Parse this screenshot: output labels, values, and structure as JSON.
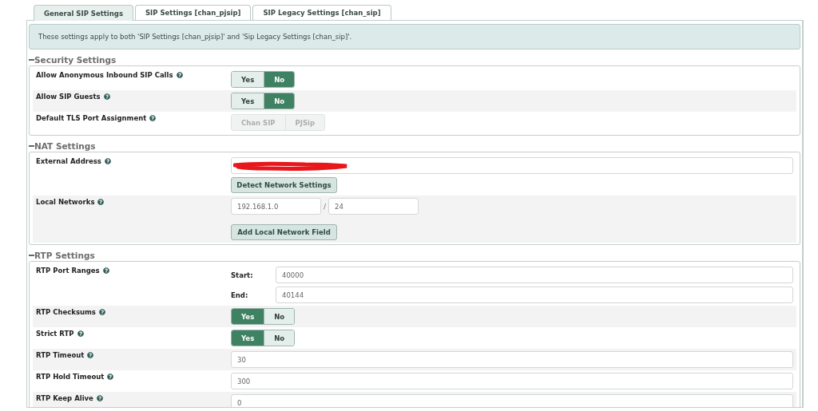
{
  "tabs": [
    {
      "label": "General SIP Settings",
      "selected": true
    },
    {
      "label": "SIP Settings [chan_pjsip]",
      "selected": false
    },
    {
      "label": "SIP Legacy Settings [chan_sip]",
      "selected": false
    }
  ],
  "info": "These settings apply to both 'SIP Settings [chan_pjsip]' and 'Sip Legacy Settings [chan_sip]'.",
  "sections": [
    {
      "title": "Security Settings",
      "expanded": true,
      "rows": [
        {
          "kind": "toggle",
          "label": "Allow Anonymous Inbound SIP Calls",
          "disabled": false,
          "options": [
            {
              "label": "Yes",
              "selected": false
            },
            {
              "label": "No",
              "selected": true
            }
          ]
        },
        {
          "kind": "toggle",
          "label": "Allow SIP Guests",
          "disabled": false,
          "options": [
            {
              "label": "Yes",
              "selected": false
            },
            {
              "label": "No",
              "selected": true
            }
          ]
        },
        {
          "kind": "toggle",
          "label": "Default TLS Port Assignment",
          "disabled": true,
          "options": [
            {
              "label": "Chan SIP",
              "selected": false
            },
            {
              "label": "PJSip",
              "selected": false
            }
          ]
        }
      ]
    },
    {
      "title": "NAT Settings",
      "expanded": true,
      "rows": [
        {
          "kind": "redacted",
          "label": "External Address",
          "button": "Detect Network Settings"
        },
        {
          "kind": "network",
          "label": "Local Networks",
          "address": "192.168.1.0",
          "separator": "/",
          "mask": "24",
          "button": "Add Local Network Field"
        }
      ]
    },
    {
      "title": "RTP Settings",
      "expanded": true,
      "rows": [
        {
          "kind": "range",
          "label": "RTP Port Ranges",
          "start_label": "Start:",
          "start": "40000",
          "end_label": "End:",
          "end": "40144"
        },
        {
          "kind": "toggle",
          "label": "RTP Checksums",
          "disabled": false,
          "options": [
            {
              "label": "Yes",
              "selected": true
            },
            {
              "label": "No",
              "selected": false
            }
          ]
        },
        {
          "kind": "toggle",
          "label": "Strict RTP",
          "disabled": false,
          "options": [
            {
              "label": "Yes",
              "selected": true
            },
            {
              "label": "No",
              "selected": false
            }
          ]
        },
        {
          "kind": "field",
          "label": "RTP Timeout",
          "value": "30"
        },
        {
          "kind": "field",
          "label": "RTP Hold Timeout",
          "value": "300"
        },
        {
          "kind": "field",
          "label": "RTP Keep Alive",
          "value": "0"
        }
      ]
    }
  ]
}
